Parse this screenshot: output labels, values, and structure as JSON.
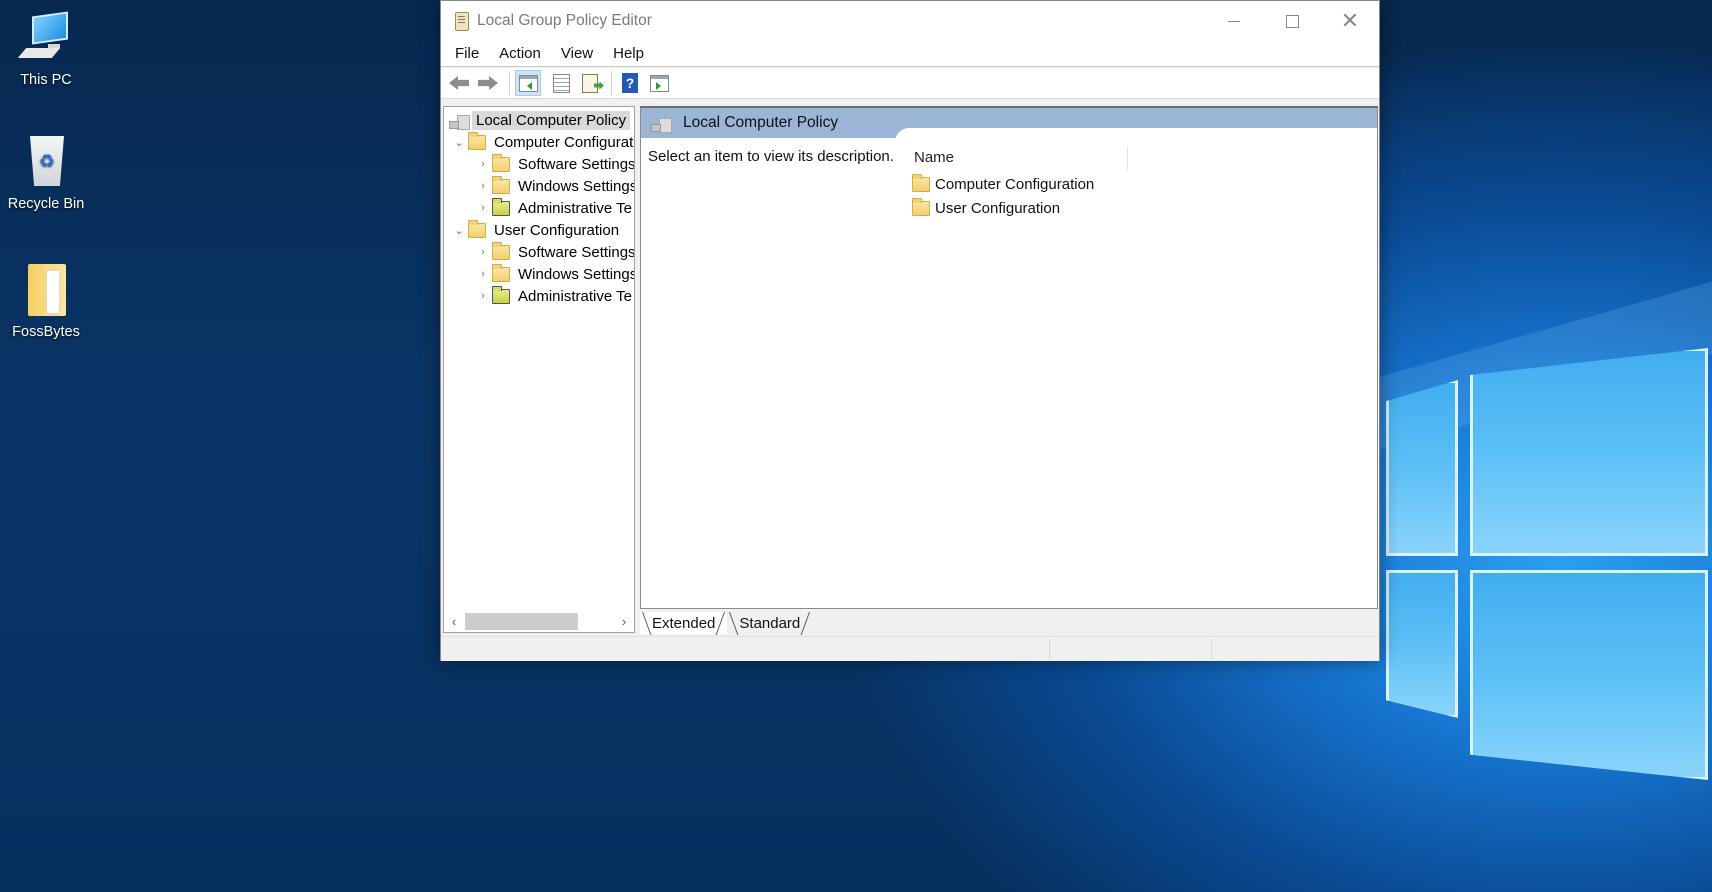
{
  "desktop": {
    "icons": [
      {
        "label": "This PC",
        "icon": "computer-icon"
      },
      {
        "label": "Recycle Bin",
        "icon": "recycle-bin-icon"
      },
      {
        "label": "FossBytes",
        "icon": "folder-icon"
      }
    ]
  },
  "window": {
    "title": "Local Group Policy Editor",
    "icon": "policy-editor-icon",
    "caption": {
      "minimize": "minimize",
      "maximize": "maximize",
      "close": "✕"
    }
  },
  "menu": [
    "File",
    "Action",
    "View",
    "Help"
  ],
  "toolbar": {
    "buttons": [
      {
        "name": "back",
        "icon": "back-arrow-icon"
      },
      {
        "name": "forward",
        "icon": "forward-arrow-icon"
      },
      {
        "name": "show-hide-console-tree",
        "icon": "console-tree-icon",
        "active": true
      },
      {
        "name": "properties",
        "icon": "properties-icon"
      },
      {
        "name": "export-list",
        "icon": "export-list-icon"
      },
      {
        "name": "help",
        "icon": "help-icon",
        "glyph": "?"
      },
      {
        "name": "show-hide-action-pane",
        "icon": "action-pane-icon"
      }
    ]
  },
  "tree": {
    "root": "Local Computer Policy",
    "nodes": [
      {
        "label": "Computer Configurat",
        "level": 1,
        "expanded": true,
        "chevron": "⌄"
      },
      {
        "label": "Software Settings",
        "level": 2,
        "chevron": "›"
      },
      {
        "label": "Windows Settings",
        "level": 2,
        "chevron": "›"
      },
      {
        "label": "Administrative Te",
        "level": 2,
        "chevron": "›",
        "admin": true
      },
      {
        "label": "User Configuration",
        "level": 1,
        "expanded": true,
        "chevron": "⌄"
      },
      {
        "label": "Software Settings",
        "level": 2,
        "chevron": "›"
      },
      {
        "label": "Windows Settings",
        "level": 2,
        "chevron": "›"
      },
      {
        "label": "Administrative Te",
        "level": 2,
        "chevron": "›",
        "admin": true
      }
    ],
    "scroll_left": "‹",
    "scroll_right": "›"
  },
  "details": {
    "header": "Local Computer Policy",
    "description": "Select an item to view its description.",
    "column_name": "Name",
    "items": [
      "Computer Configuration",
      "User Configuration"
    ]
  },
  "tabs": [
    {
      "label": "Extended",
      "active": true
    },
    {
      "label": "Standard",
      "active": false
    }
  ],
  "colors": {
    "header_band": "#9ab5d6",
    "selection": "#d9d9d9",
    "toolbar_active": "#cce4f7"
  }
}
